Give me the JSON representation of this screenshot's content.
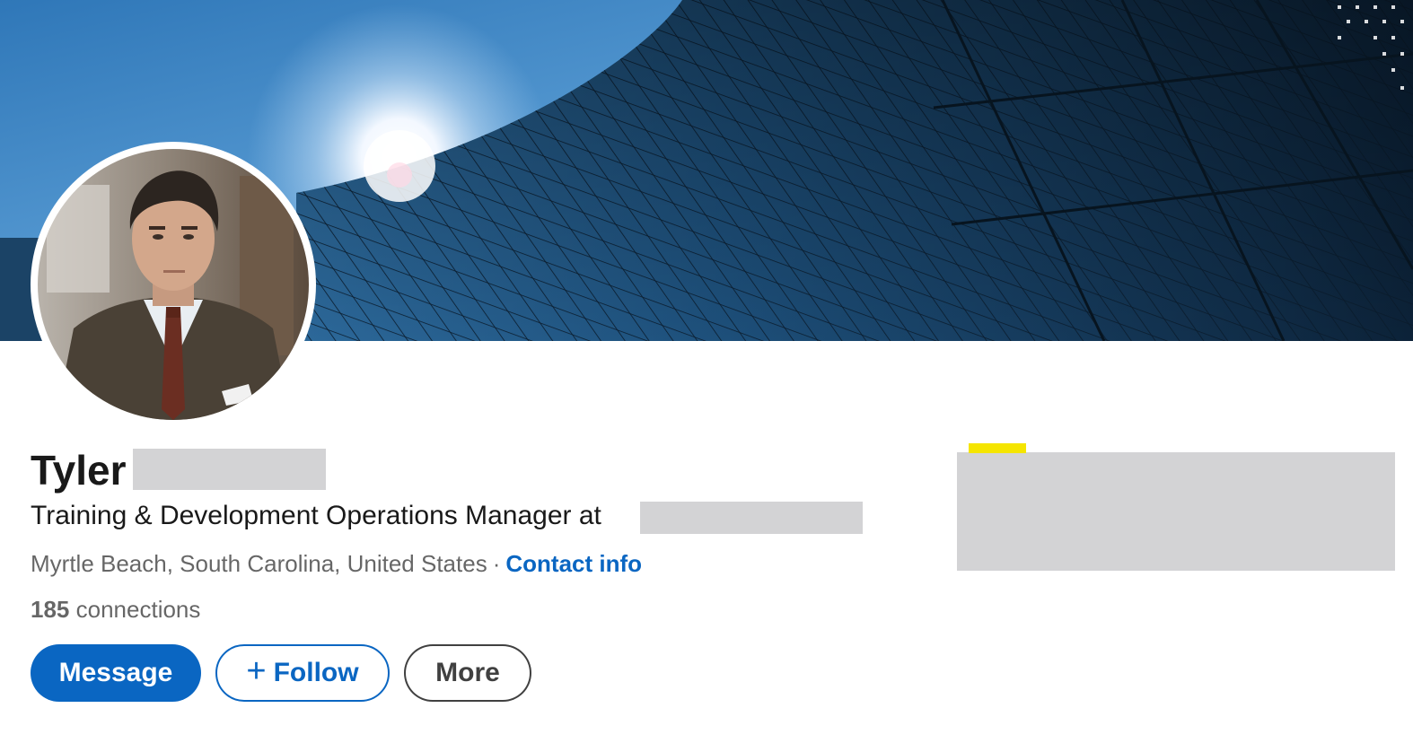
{
  "profile": {
    "first_name": "Tyler",
    "headline": "Training & Development Operations Manager at",
    "location": "Myrtle Beach, South Carolina, United States",
    "separator": "·",
    "contact_label": "Contact info",
    "connections_count": "185",
    "connections_label": "connections"
  },
  "actions": {
    "message_label": "Message",
    "follow_icon": "+",
    "follow_label": "Follow",
    "more_label": "More"
  },
  "icons": {
    "follow": "plus-icon"
  },
  "colors": {
    "brand_blue": "#0a66c2",
    "redaction_gray": "#d3d3d5",
    "highlight_yellow": "#f5e500"
  }
}
